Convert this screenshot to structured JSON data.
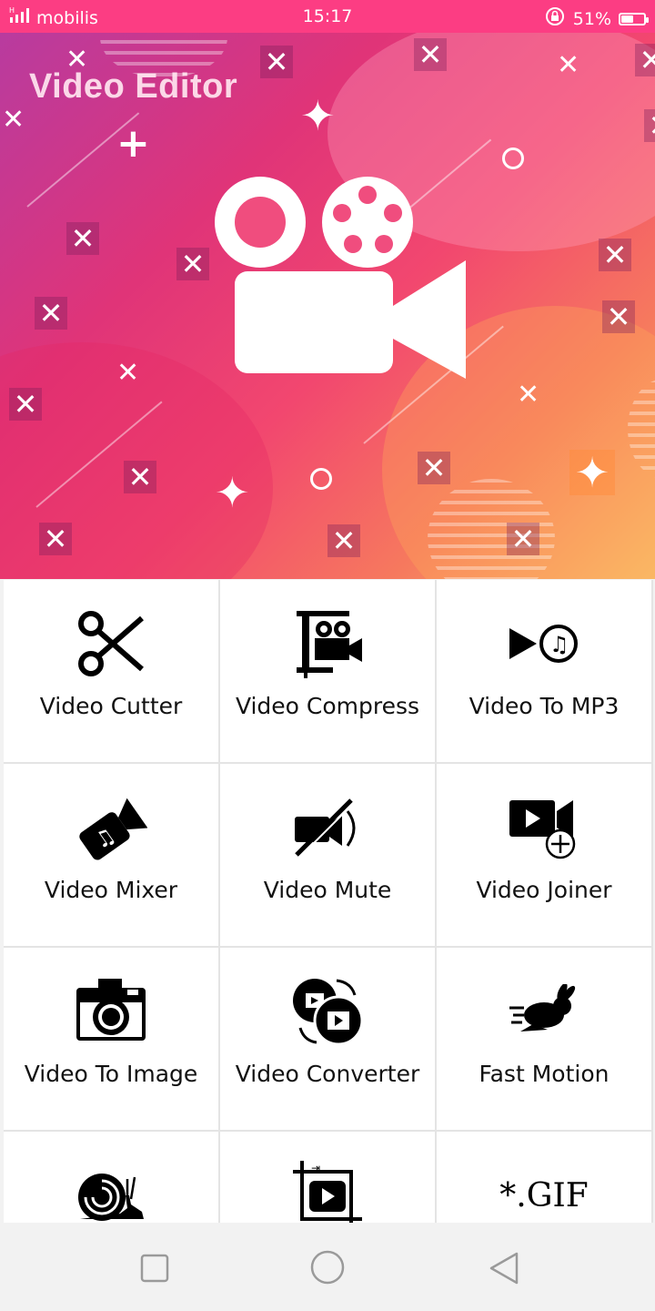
{
  "status_bar": {
    "carrier": "mobilis",
    "signal_prefix": "H",
    "time": "15:17",
    "battery_percent_label": "51%",
    "battery_level": 0.51,
    "icons": [
      "signal-icon",
      "rotation-lock-icon",
      "battery-icon"
    ]
  },
  "banner": {
    "title": "Video Editor",
    "logo_icon": "movie-camera-icon"
  },
  "tools": [
    {
      "label": "Video Cutter",
      "icon": "scissors-icon"
    },
    {
      "label": "Video Compress",
      "icon": "compress-camera-icon"
    },
    {
      "label": "Video To MP3",
      "icon": "play-music-icon"
    },
    {
      "label": "Video Mixer",
      "icon": "music-camera-icon"
    },
    {
      "label": "Video Mute",
      "icon": "muted-camera-icon"
    },
    {
      "label": "Video Joiner",
      "icon": "video-add-icon"
    },
    {
      "label": "Video To Image",
      "icon": "camera-icon"
    },
    {
      "label": "Video Converter",
      "icon": "convert-film-icon"
    },
    {
      "label": "Fast Motion",
      "icon": "rabbit-icon"
    },
    {
      "label": "",
      "icon": "snail-icon"
    },
    {
      "label": "",
      "icon": "crop-video-icon"
    },
    {
      "label": "*.GIF",
      "icon": "gif-icon"
    }
  ],
  "nav_bar": {
    "icons": [
      "recent-apps-icon",
      "home-icon",
      "back-icon"
    ]
  },
  "colors": {
    "status_bar": "#fc3d83",
    "banner_start": "#b83b9f",
    "banner_end": "#f8c06a",
    "tile_bg": "#ffffff",
    "grid_line": "#e4e4e4",
    "nav_bg": "#f2f2f2"
  }
}
